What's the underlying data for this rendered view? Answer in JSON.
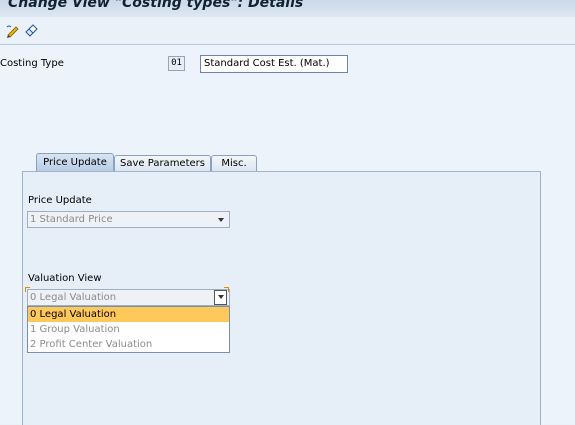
{
  "window": {
    "title": "Change View \"Costing types\": Details"
  },
  "toolbar": {
    "icons": [
      "edit-pencil-icon",
      "other-view-icon"
    ]
  },
  "header": {
    "costing_type_label": "Costing Type",
    "costing_type_code": "01",
    "costing_type_desc": "Standard Cost Est. (Mat.)"
  },
  "tabs": [
    {
      "label": "Price Update",
      "active": true
    },
    {
      "label": "Save Parameters",
      "active": false
    },
    {
      "label": "Misc.",
      "active": false
    }
  ],
  "price_update": {
    "label": "Price Update",
    "selected": "1 Standard Price"
  },
  "valuation_view": {
    "label": "Valuation View",
    "selected": "0 Legal Valuation",
    "options": [
      {
        "label": "0 Legal Valuation",
        "highlighted": true
      },
      {
        "label": "1 Group Valuation",
        "highlighted": false
      },
      {
        "label": "2 Profit Center Valuation",
        "highlighted": false
      }
    ]
  },
  "colors": {
    "highlight": "#ffc85a",
    "focus": "#e08a00"
  }
}
